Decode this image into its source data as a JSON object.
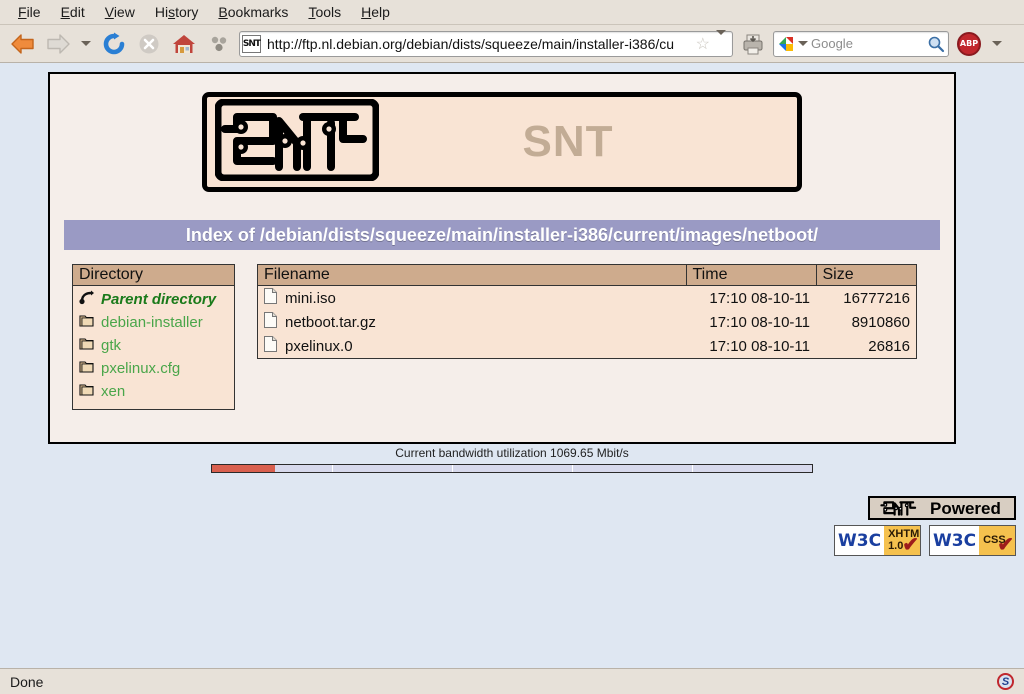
{
  "browser": {
    "menu": [
      {
        "label": "File",
        "accel": "F"
      },
      {
        "label": "Edit",
        "accel": "E"
      },
      {
        "label": "View",
        "accel": "V"
      },
      {
        "label": "History",
        "accel": "s"
      },
      {
        "label": "Bookmarks",
        "accel": "B"
      },
      {
        "label": "Tools",
        "accel": "T"
      },
      {
        "label": "Help",
        "accel": "H"
      }
    ],
    "toolbar": {
      "back": "back-button",
      "forward": "forward-button",
      "reload": "reload-button",
      "stop": "stop-button",
      "home": "home-button",
      "print": "print-button"
    },
    "url": {
      "value": "http://ftp.nl.debian.org/debian/dists/squeeze/main/installer-i386/cu",
      "favicon_text": "SNT"
    },
    "search": {
      "placeholder": "Google",
      "engine": "Google"
    },
    "adblock_label": "ABP",
    "statusbar": {
      "text": "Done",
      "noscript_label": "S"
    }
  },
  "page": {
    "banner_title": "SNT",
    "index_title": "Index of /debian/dists/squeeze/main/installer-i386/current/images/netboot/",
    "directory": {
      "header": "Directory",
      "items": [
        {
          "label": "Parent directory",
          "icon": "parent-directory-icon",
          "parent": true
        },
        {
          "label": "debian-installer",
          "icon": "folder-icon",
          "parent": false
        },
        {
          "label": "gtk",
          "icon": "folder-icon",
          "parent": false
        },
        {
          "label": "pxelinux.cfg",
          "icon": "folder-icon",
          "parent": false
        },
        {
          "label": "xen",
          "icon": "folder-icon",
          "parent": false
        }
      ]
    },
    "files": {
      "columns": [
        "Filename",
        "Time",
        "Size"
      ],
      "rows": [
        {
          "name": "mini.iso",
          "time": "17:10 08-10-11",
          "size": "16777216"
        },
        {
          "name": "netboot.tar.gz",
          "time": "17:10 08-10-11",
          "size": "8910860"
        },
        {
          "name": "pxelinux.0",
          "time": "17:10 08-10-11",
          "size": "26816"
        }
      ]
    },
    "bandwidth": {
      "label": "Current bandwidth utilization 1069.65 Mbit/s",
      "value": "1069.65",
      "unit": "Mbit/s",
      "fill_percent": 10.5
    },
    "badges": {
      "powered": "Powered",
      "xhtml": {
        "org": "W3C",
        "line1": "XHTML",
        "line2": "1.0",
        "check": "✔"
      },
      "css": {
        "org": "W3C",
        "line1": "CSS",
        "check": "✔"
      }
    }
  },
  "colors": {
    "viewport_bg": "#dfe7f2",
    "content_bg": "#f5eeea",
    "banner_bg": "#f9e4d4",
    "title_bar": "#9a9ac4",
    "table_header": "#ceab8d",
    "link_green": "#4aa64a",
    "parent_green": "#1a7a1a",
    "bandwidth_fill": "#d9604f"
  }
}
